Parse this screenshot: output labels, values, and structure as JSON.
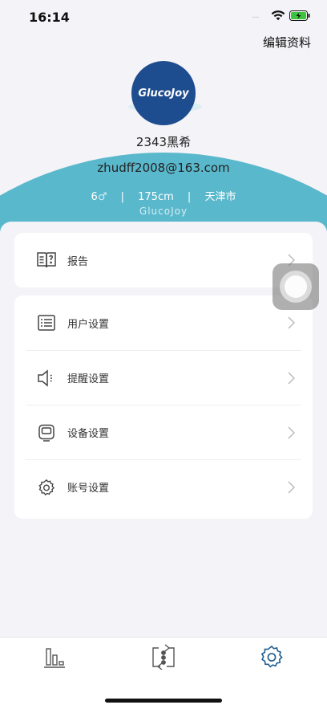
{
  "status_bar": {
    "time": "16:14",
    "signal": "····"
  },
  "header": {
    "edit_label": "编辑资料",
    "avatar_text": "GlucoJoy",
    "username": "2343黑希",
    "email": "zhudff2008@163.com",
    "age": "6",
    "gender_symbol": "♂",
    "height": "175cm",
    "city": "天津市",
    "separator": "|",
    "watermark": "GlucoJoy"
  },
  "menu": {
    "report": {
      "label": "报告",
      "icon": "book-icon"
    },
    "settings": [
      {
        "label": "用户设置",
        "icon": "list-icon"
      },
      {
        "label": "提醒设置",
        "icon": "speaker-icon"
      },
      {
        "label": "设备设置",
        "icon": "device-icon"
      },
      {
        "label": "账号设置",
        "icon": "gear-icon"
      }
    ]
  },
  "tabbar": {
    "items": [
      {
        "name": "data",
        "icon": "bar-chart-icon"
      },
      {
        "name": "sync",
        "icon": "sync-icon"
      },
      {
        "name": "settings",
        "icon": "gear-icon",
        "active": true
      }
    ]
  },
  "colors": {
    "header_accent": "#5ab8cc",
    "avatar_bg": "#1d4c8f",
    "active_tab": "#1d5d8f",
    "inactive_tab": "#555555",
    "background": "#f4f3f7"
  }
}
